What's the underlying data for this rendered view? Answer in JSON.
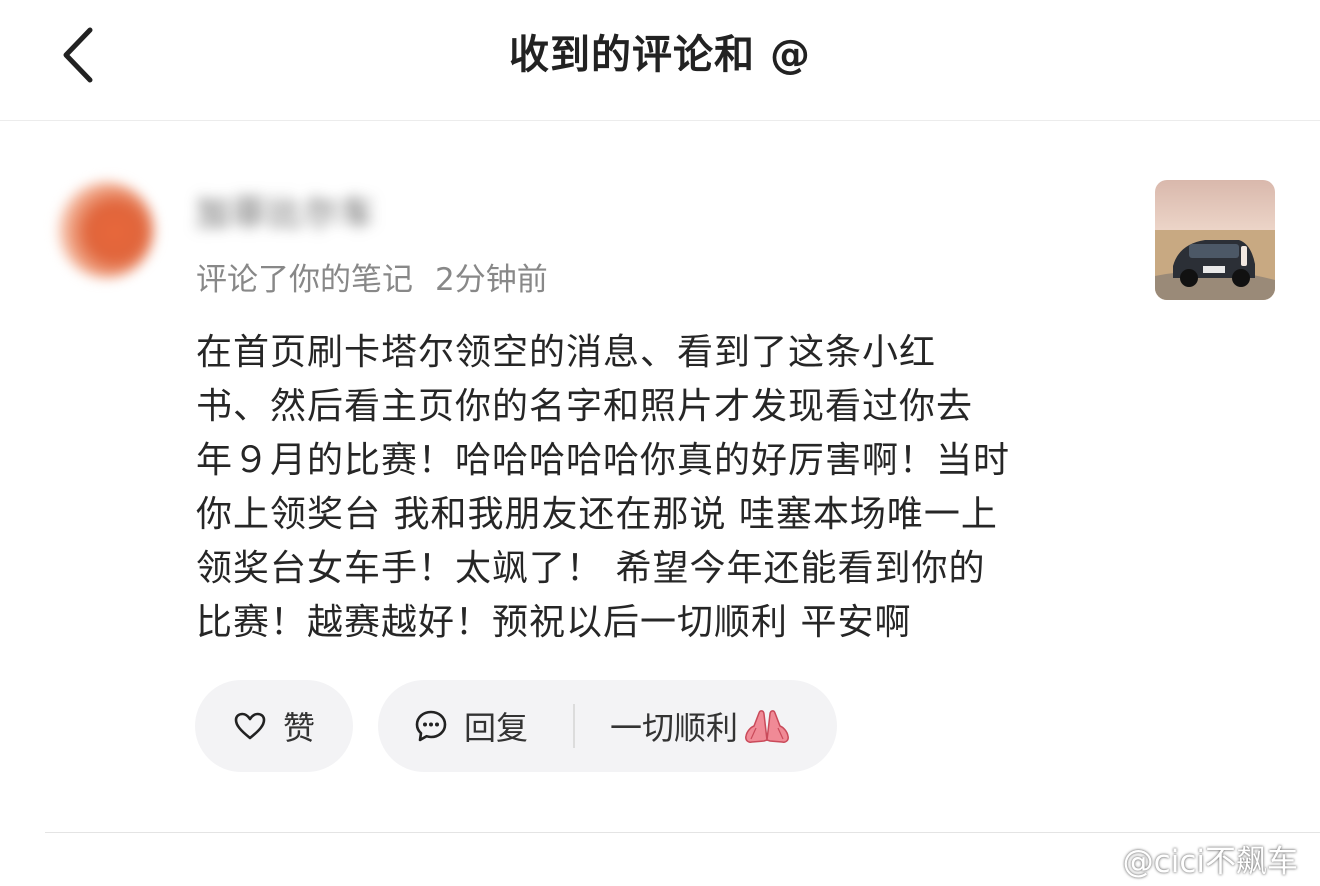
{
  "header": {
    "title": "收到的评论和 @"
  },
  "comment": {
    "username": "加菲比尔车",
    "action": "评论了你的笔记",
    "time": "2分钟前",
    "lines": [
      "在首页刷卡塔尔领空的消息、看到了这条小红",
      "书、然后看主页你的名字和照片才发现看过你去",
      "年９月的比赛！哈哈哈哈哈你真的好厉害啊！当时",
      "你上领奖台 我和我朋友还在那说 哇塞本场唯一上",
      "领奖台女车手！太飒了！ 希望今年还能看到你的",
      "比赛！越赛越好！预祝以后一切顺利 平安啊"
    ]
  },
  "actions": {
    "like_label": "赞",
    "reply_label": "回复",
    "quick_reply_label": "一切顺利"
  },
  "watermark": {
    "text": "@cici不飙车"
  },
  "colors": {
    "background": "#ffffff",
    "pill_background": "#f3f3f5",
    "meta_text": "#888888",
    "avatar_accent": "#e0643a"
  }
}
